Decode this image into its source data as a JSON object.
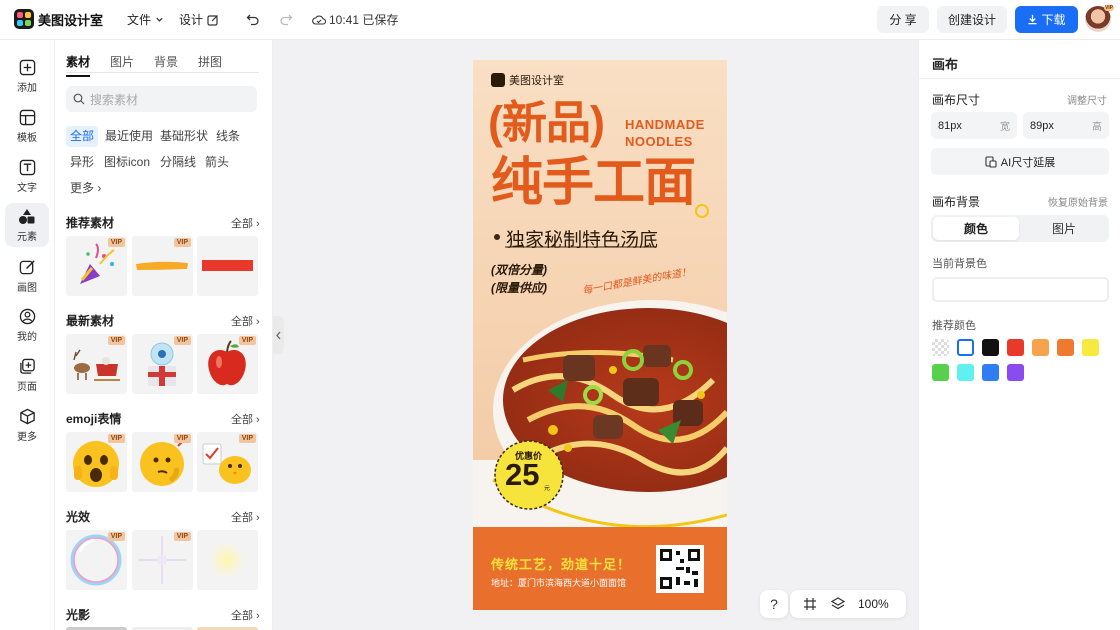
{
  "app": {
    "name": "美图设计室"
  },
  "topbar": {
    "file_menu": "文件",
    "design_menu": "设计",
    "save_status": "10:41 已保存",
    "share_label": "分 享",
    "create_label": "创建设计",
    "download_label": "下载",
    "avatar_badge": "VIP"
  },
  "rail": {
    "items": [
      {
        "label": "添加",
        "icon": "plus-icon"
      },
      {
        "label": "模板",
        "icon": "template-icon"
      },
      {
        "label": "文字",
        "icon": "text-icon"
      },
      {
        "label": "元素",
        "icon": "shapes-icon"
      },
      {
        "label": "画图",
        "icon": "pencil-icon"
      },
      {
        "label": "我的",
        "icon": "user-icon"
      },
      {
        "label": "页面",
        "icon": "page-add-icon"
      },
      {
        "label": "更多",
        "icon": "cube-icon"
      }
    ],
    "active": 3
  },
  "panel": {
    "tabs": [
      "素材",
      "图片",
      "背景",
      "拼图"
    ],
    "search_placeholder": "搜索素材",
    "chips": [
      "全部",
      "最近使用",
      "基础形状",
      "线条",
      "异形",
      "图标icon",
      "分隔线",
      "箭头",
      "更多"
    ],
    "see_all": "全部",
    "vip": "VIP",
    "sections": [
      "推荐素材",
      "最新素材",
      "emoji表情",
      "光效",
      "光影"
    ]
  },
  "poster": {
    "brand": "美图设计室",
    "headline1": "(新品)",
    "headline2": "纯手工面",
    "english1": "HANDMADE",
    "english2": "NOODLES",
    "tagline": "独家秘制特色汤底",
    "promo1": "(双倍分量)",
    "promo2": "(限量供应)",
    "slogan": "每一口都是鲜美的味道！",
    "price_label": "优惠价",
    "price": "25",
    "price_unit": "元",
    "bottom_line": "传统工艺，劲道十足！",
    "address": "地址：厦门市滨海西大道小面面馆"
  },
  "canvas_tools": {
    "help": "?",
    "zoom": "100%"
  },
  "right_panel": {
    "title": "画布",
    "size_label": "画布尺寸",
    "adjust_size": "调整尺寸",
    "width_value": "81px",
    "width_unit": "宽",
    "height_value": "89px",
    "height_unit": "高",
    "ai_extend": "AI尺寸延展",
    "bg_label": "画布背景",
    "restore_bg": "恢复原始背景",
    "bg_tabs": [
      "颜色",
      "图片"
    ],
    "current_bg_label": "当前背景色",
    "recommend_label": "推荐颜色",
    "colors": [
      "transparent",
      "#ffffff",
      "#111111",
      "#e8392b",
      "#f5a44b",
      "#ee7a30",
      "#f7ea3f",
      "#58d04b",
      "#5ff0f0",
      "#2f7df0",
      "#8a4cf0"
    ]
  },
  "accent_color": "#1a6ef5"
}
